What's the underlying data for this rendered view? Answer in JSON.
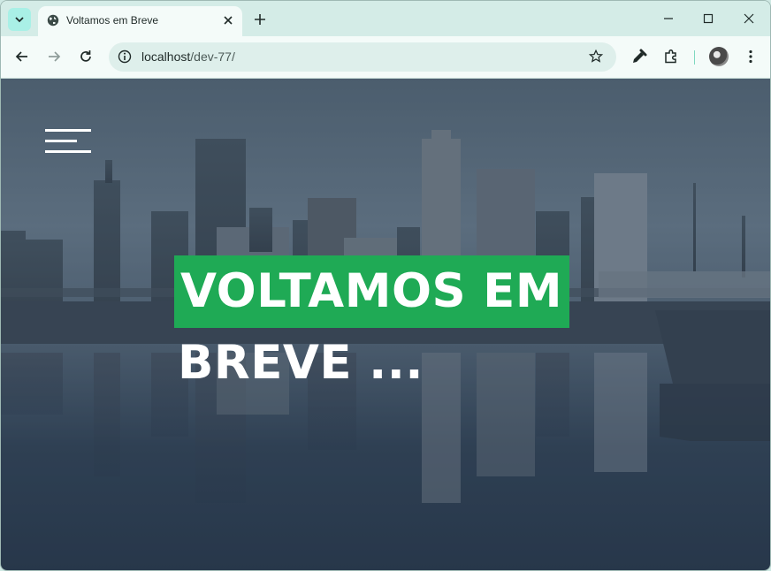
{
  "browser": {
    "tab_title": "Voltamos em Breve",
    "url_host": "localhost",
    "url_path": "/dev-77/"
  },
  "page": {
    "headline_line1": "VOLTAMOS EM",
    "headline_line2": "BREVE ...",
    "accent_color": "#1faa55"
  },
  "icons": [
    "tab-search-icon",
    "globe-icon",
    "close-icon",
    "plus-icon",
    "minimize-icon",
    "maximize-icon",
    "close-window-icon",
    "back-icon",
    "forward-icon",
    "reload-icon",
    "site-info-icon",
    "bookmark-star-icon",
    "eyedropper-icon",
    "extensions-icon",
    "profile-avatar",
    "more-menu-icon",
    "hamburger-menu-icon"
  ]
}
